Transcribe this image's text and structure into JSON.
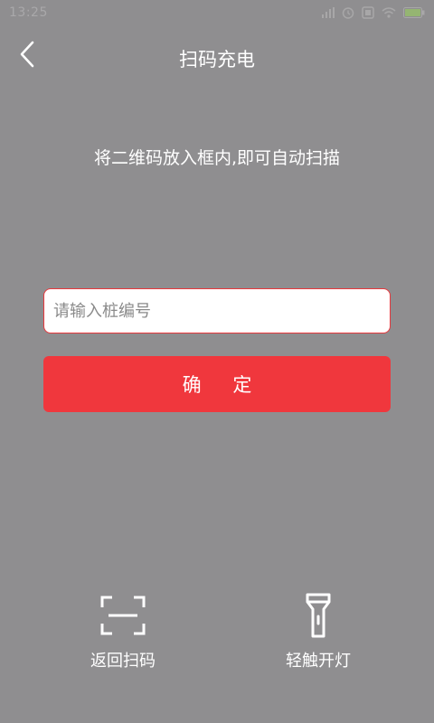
{
  "status_bar": {
    "time": "13:25"
  },
  "header": {
    "title": "扫码充电",
    "back_icon": "chevron-left-icon"
  },
  "instruction": "将二维码放入框内,即可自动扫描",
  "form": {
    "input_placeholder": "请输入桩编号",
    "input_value": "",
    "confirm_label": "确 定"
  },
  "bottom_actions": [
    {
      "label": "返回扫码",
      "icon": "scan-frame-icon"
    },
    {
      "label": "轻触开灯",
      "icon": "flashlight-icon"
    }
  ],
  "colors": {
    "background": "#8f8e90",
    "accent": "#f0373d",
    "input_border": "#e8383d",
    "text": "#ffffff"
  }
}
